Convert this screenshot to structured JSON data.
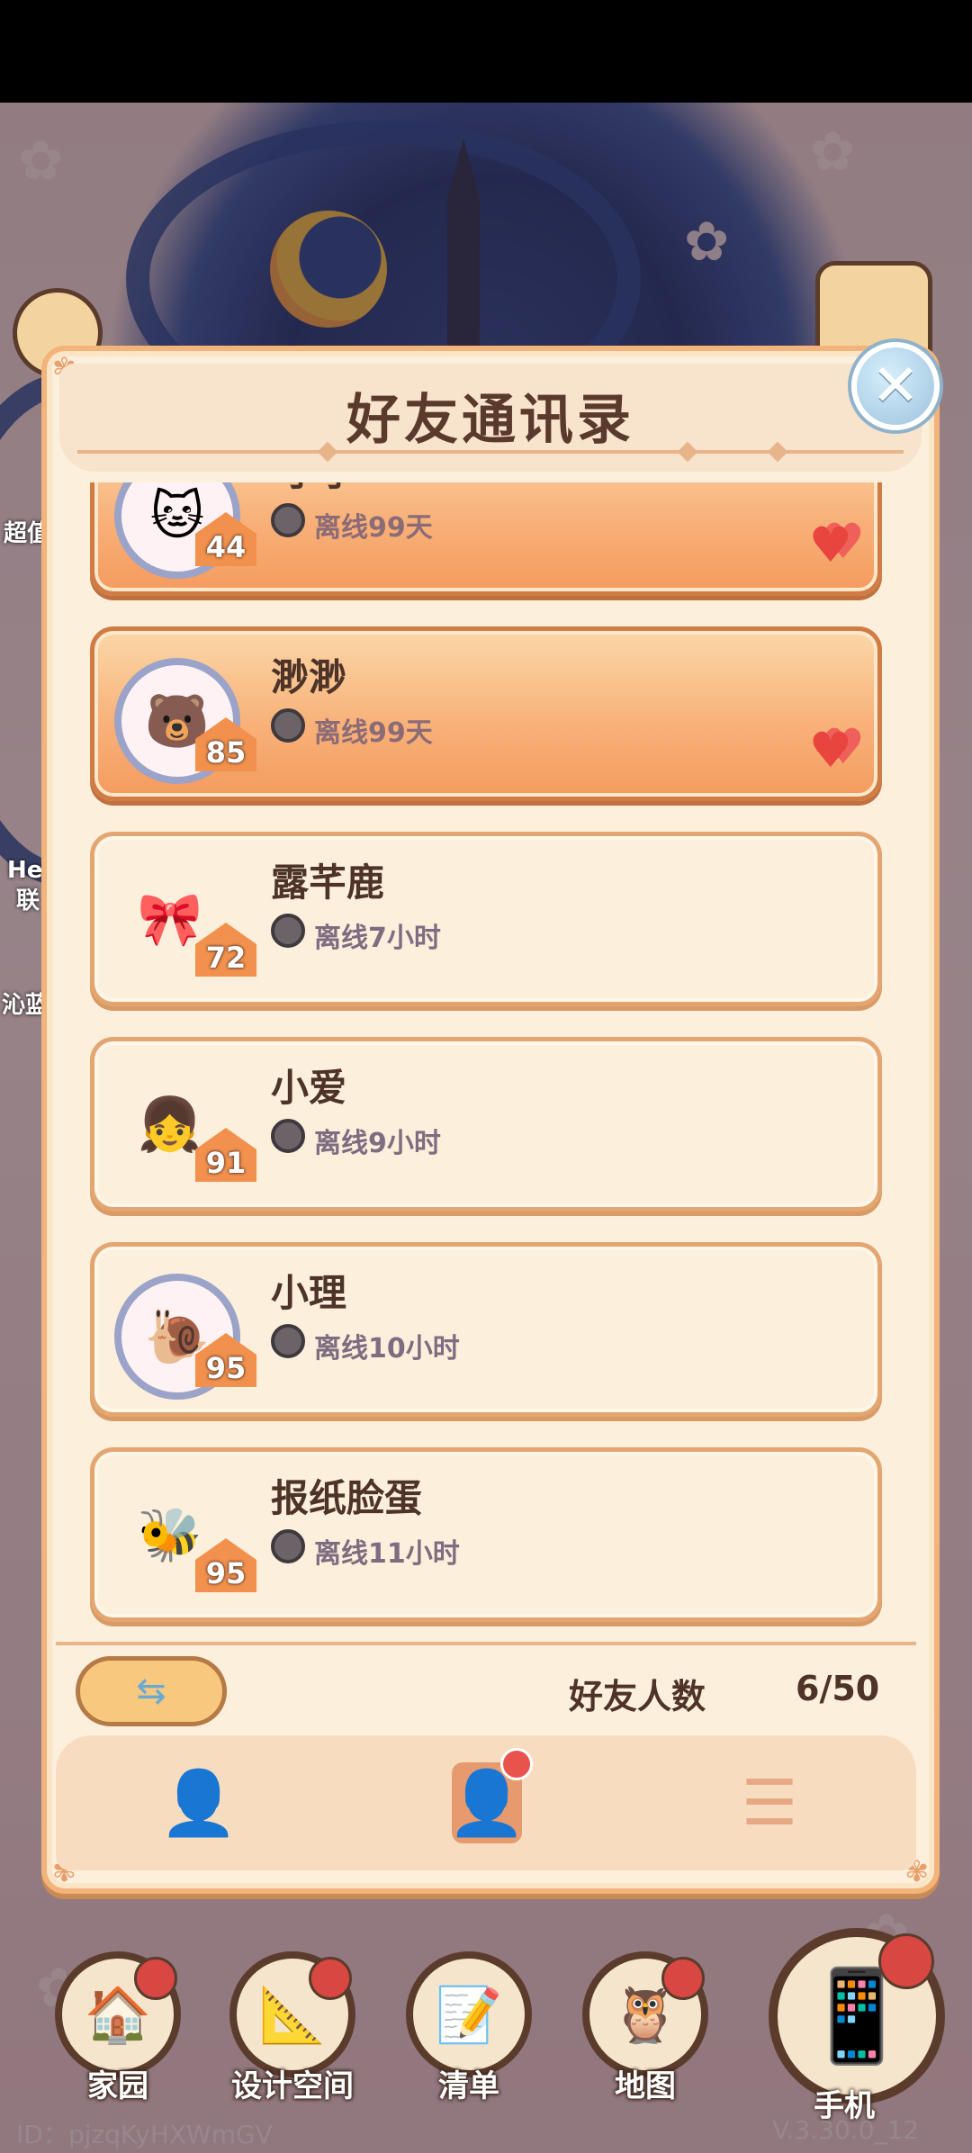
{
  "dialog": {
    "title": "好友通讯录",
    "close_icon": "close-icon"
  },
  "friends": [
    {
      "name": "可可",
      "level": "44",
      "status": "离线99天",
      "avatar": "cat-avatar",
      "highlight": true,
      "heart": true
    },
    {
      "name": "渺渺",
      "level": "85",
      "status": "离线99天",
      "avatar": "bear-avatar",
      "highlight": true,
      "heart": true
    },
    {
      "name": "露芊鹿",
      "level": "72",
      "status": "离线7小时",
      "avatar": "axolotl-avatar",
      "highlight": false,
      "heart": false
    },
    {
      "name": "小爱",
      "level": "91",
      "status": "离线9小时",
      "avatar": "girl-avatar",
      "highlight": false,
      "heart": false
    },
    {
      "name": "小理",
      "level": "95",
      "status": "离线10小时",
      "avatar": "snail-avatar",
      "highlight": false,
      "heart": false
    },
    {
      "name": "报纸脸蛋",
      "level": "95",
      "status": "离线11小时",
      "avatar": "bee-avatar",
      "highlight": false,
      "heart": false
    }
  ],
  "footer": {
    "count_label": "好友人数",
    "count_value": "6/50"
  },
  "tabs": [
    {
      "icon": "add-friend-icon",
      "active": false
    },
    {
      "icon": "contacts-icon",
      "active": true,
      "badge": true
    },
    {
      "icon": "list-icon",
      "active": false
    }
  ],
  "bottom_nav": [
    {
      "label": "家园",
      "icon": "home-icon"
    },
    {
      "label": "设计空间",
      "icon": "design-icon"
    },
    {
      "label": "清单",
      "icon": "checklist-icon"
    },
    {
      "label": "地图",
      "icon": "owl-map-icon"
    }
  ],
  "phone": {
    "label": "手机",
    "icon": "phone-icon"
  },
  "side_labels": {
    "left1": "超值",
    "left2": "He",
    "left3": "联",
    "left4": "沁蓝"
  },
  "account": {
    "id": "ID：pjzqKyHXWmGV",
    "version": "V.3.30.0_12"
  }
}
